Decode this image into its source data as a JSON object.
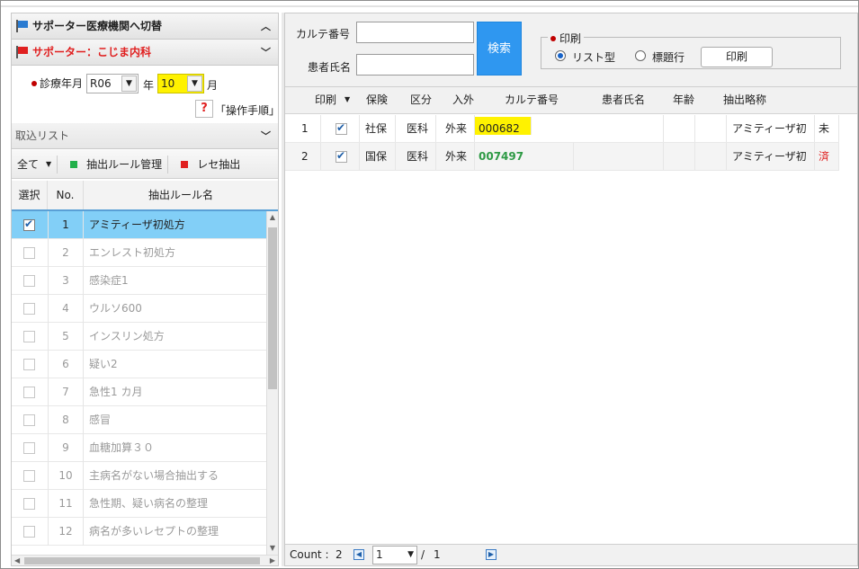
{
  "left": {
    "switch_header": "サポーター医療機関へ切替",
    "supporter_header": "サポーター：こじま内科",
    "date": {
      "label": "診療年月",
      "era_value": "R06",
      "year_unit": "年",
      "month_value": "10",
      "month_unit": "月"
    },
    "help": {
      "icon_text": "?",
      "link": "「操作手順」"
    },
    "import_list_header": "取込リスト",
    "toolbar": {
      "all_label": "全て",
      "rule_manage_label": "抽出ルール管理",
      "rece_extract_label": "レセ抽出"
    },
    "grid": {
      "headers": {
        "select": "選択",
        "no": "No.",
        "name": "抽出ルール名"
      },
      "rows": [
        {
          "no": "1",
          "name": "アミティーザ初処方"
        },
        {
          "no": "2",
          "name": "エンレスト初処方"
        },
        {
          "no": "3",
          "name": "感染症1"
        },
        {
          "no": "4",
          "name": "ウルソ600"
        },
        {
          "no": "5",
          "name": "インスリン処方"
        },
        {
          "no": "6",
          "name": "疑い2"
        },
        {
          "no": "7",
          "name": "急性1 カ月"
        },
        {
          "no": "8",
          "name": "感冒"
        },
        {
          "no": "9",
          "name": "血糖加算３０"
        },
        {
          "no": "10",
          "name": "主病名がない場合抽出する"
        },
        {
          "no": "11",
          "name": "急性期、疑い病名の整理"
        },
        {
          "no": "12",
          "name": "病名が多いレセプトの整理"
        }
      ]
    }
  },
  "right": {
    "search": {
      "karte_label": "カルテ番号",
      "karte_value": "",
      "patient_label": "患者氏名",
      "patient_value": "",
      "search_button": "検索"
    },
    "print_group": {
      "legend": "印刷",
      "radio_list": "リスト型",
      "radio_header": "標題行",
      "print_button": "印刷"
    },
    "table": {
      "headers": {
        "print": "印刷",
        "insurance": "保険",
        "category": "区分",
        "inout": "入外",
        "karte": "カルテ番号",
        "patient": "患者氏名",
        "age": "年齢",
        "abbr": "抽出略称"
      },
      "rows": [
        {
          "idx": "1",
          "insurance": "社保",
          "category": "医科",
          "inout": "外来",
          "karte": "000682",
          "patient": "",
          "age": "",
          "abbr": "アミティーザ初",
          "status": "未",
          "status_color": "#222222"
        },
        {
          "idx": "2",
          "insurance": "国保",
          "category": "医科",
          "inout": "外来",
          "karte": "007497",
          "patient": "",
          "age": "",
          "abbr": "アミティーザ初",
          "status": "済",
          "status_color": "#e02020"
        }
      ]
    },
    "footer": {
      "count_label": "Count :",
      "count_value": "2",
      "page_value": "1",
      "page_sep": "/",
      "page_total": "1"
    }
  },
  "colors": {
    "selected_row": "#82cff7",
    "search_button": "#2f97f0",
    "highlight": "#fff200",
    "karte_green": "#2e9a45",
    "red": "#e02020",
    "green_square": "#22b04a"
  }
}
